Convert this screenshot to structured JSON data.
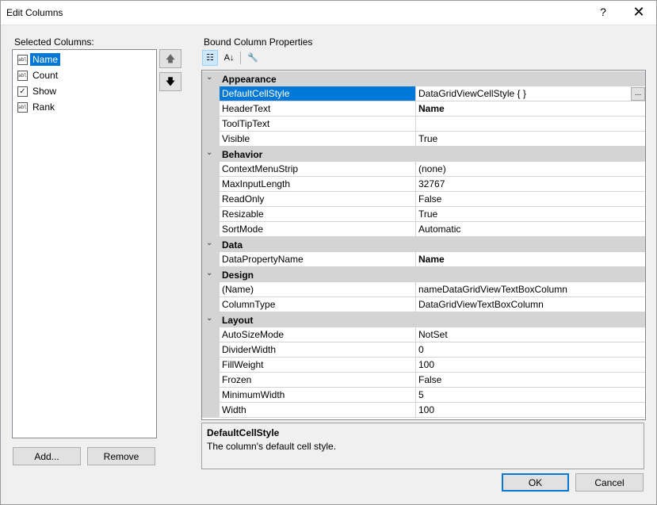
{
  "window": {
    "title": "Edit Columns",
    "help": "?",
    "close": "✕"
  },
  "left": {
    "label": "Selected Columns:",
    "columns": [
      {
        "label": "Name",
        "icon": "textbox-column-icon",
        "selected": true
      },
      {
        "label": "Count",
        "icon": "textbox-column-icon"
      },
      {
        "label": "Show",
        "icon": "checkbox-column-icon"
      },
      {
        "label": "Rank",
        "icon": "textbox-column-icon"
      }
    ],
    "move_up": "🡅",
    "move_down": "🡇",
    "add": "Add...",
    "remove": "Remove"
  },
  "right": {
    "label": "Bound Column Properties",
    "categories": [
      {
        "name": "Appearance",
        "props": [
          {
            "name": "DefaultCellStyle",
            "value": "DataGridViewCellStyle { }",
            "selected": true,
            "ellipsis": true
          },
          {
            "name": "HeaderText",
            "value": "Name",
            "bold": true
          },
          {
            "name": "ToolTipText",
            "value": ""
          },
          {
            "name": "Visible",
            "value": "True"
          }
        ]
      },
      {
        "name": "Behavior",
        "props": [
          {
            "name": "ContextMenuStrip",
            "value": "(none)"
          },
          {
            "name": "MaxInputLength",
            "value": "32767"
          },
          {
            "name": "ReadOnly",
            "value": "False"
          },
          {
            "name": "Resizable",
            "value": "True"
          },
          {
            "name": "SortMode",
            "value": "Automatic"
          }
        ]
      },
      {
        "name": "Data",
        "props": [
          {
            "name": "DataPropertyName",
            "value": "Name",
            "bold": true
          }
        ]
      },
      {
        "name": "Design",
        "props": [
          {
            "name": "(Name)",
            "value": "nameDataGridViewTextBoxColumn"
          },
          {
            "name": "ColumnType",
            "value": "DataGridViewTextBoxColumn"
          }
        ]
      },
      {
        "name": "Layout",
        "props": [
          {
            "name": "AutoSizeMode",
            "value": "NotSet"
          },
          {
            "name": "DividerWidth",
            "value": "0"
          },
          {
            "name": "FillWeight",
            "value": "100"
          },
          {
            "name": "Frozen",
            "value": "False"
          },
          {
            "name": "MinimumWidth",
            "value": "5"
          },
          {
            "name": "Width",
            "value": "100"
          }
        ]
      }
    ],
    "description": {
      "title": "DefaultCellStyle",
      "text": "The column's default cell style."
    }
  },
  "footer": {
    "ok": "OK",
    "cancel": "Cancel"
  },
  "colors": {
    "accent": "#0078d7",
    "category_bg": "#d4d4d4"
  }
}
